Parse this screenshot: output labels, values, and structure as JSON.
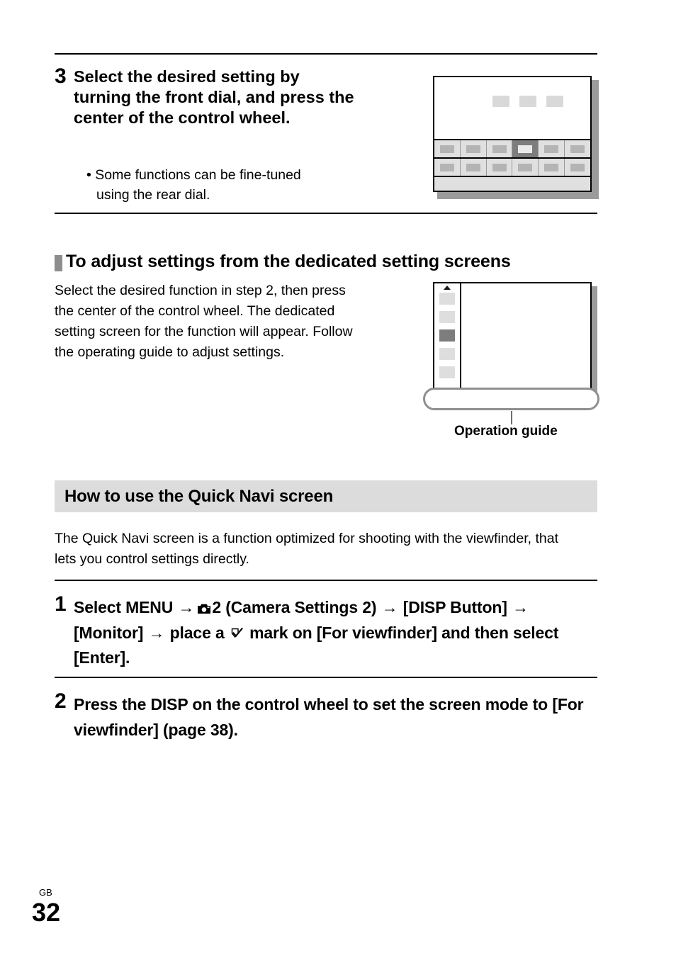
{
  "page": {
    "language_code": "GB",
    "page_number": "32"
  },
  "step3": {
    "number": "3",
    "heading": "Select the desired setting by turning the front dial, and press the center of the control wheel.",
    "bullet": "• Some functions can be fine-tuned using the rear dial."
  },
  "subsection": {
    "heading": "To adjust settings from the dedicated setting screens",
    "paragraph": "Select the desired function in step 2, then press the center of the control wheel. The dedicated setting screen for the function will appear. Follow the operating guide to adjust settings."
  },
  "illustration_quick_navi": {
    "top_icons": [
      "icon-1",
      "icon-2",
      "icon-3"
    ],
    "row1_cells": [
      "cell-1",
      "cell-2",
      "cell-3",
      "cell-4-selected",
      "cell-5",
      "cell-6"
    ],
    "row2_cells": [
      "cell-1",
      "cell-2",
      "cell-3",
      "cell-4",
      "cell-5",
      "cell-6"
    ],
    "selected_index": 3
  },
  "illustration_setting_screen": {
    "sidebar_items": [
      "item-1",
      "item-2",
      "item-3-selected",
      "item-4",
      "item-5"
    ],
    "selected_index": 2,
    "callout_label": "Operation guide"
  },
  "section": {
    "title": "How to use the Quick Navi screen",
    "paragraph": "The Quick Navi screen is a function optimized for shooting with the viewfinder, that lets you control settings directly."
  },
  "step1": {
    "number": "1",
    "text_part1": "Select MENU ",
    "arrow": "→",
    "text_part2": "2 (Camera Settings 2) ",
    "text_part3": "[DISP Button] ",
    "text_part4": "[Monitor] ",
    "text_part5": "place a ",
    "text_part6": " mark on [For viewfinder] and then select [Enter]."
  },
  "step2": {
    "number": "2",
    "text": "Press the DISP on the control wheel to set the screen mode to [For viewfinder] (page 38)."
  },
  "colors": {
    "band_gray": "#dcdcdc",
    "bullet_gray": "#8d8d8d",
    "selected_gray": "#7d7d7d",
    "cell_gray": "#b4b4b4",
    "icon_gray": "#d9d9d9",
    "shadow_gray": "#9b9b9b"
  }
}
